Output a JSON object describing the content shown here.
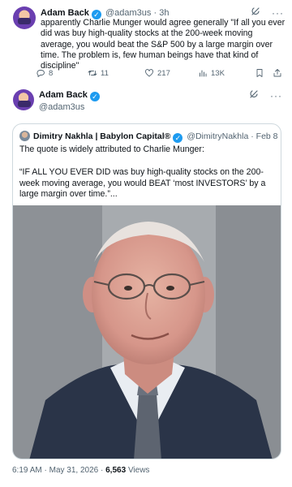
{
  "tweet": {
    "author_name": "Adam Back",
    "author_handle": "@adam3us",
    "sep": "·",
    "age": "3h",
    "text": "apparently Charlie Munger would agree generally \"If all you ever did was buy high-quality stocks at the 200-week moving average, you would beat the S&P 500 by a large margin over time. The problem is, few human beings have that kind of discipline\"",
    "actions": {
      "replies": "8",
      "retweets": "11",
      "likes": "217",
      "views": "13K"
    }
  },
  "reply": {
    "author_name": "Adam Back",
    "author_handle": "@adam3us"
  },
  "quote": {
    "author_name": "Dimitry Nakhla | Babylon Capital®",
    "author_handle": "@DimitryNakhla",
    "sep": "·",
    "date": "Feb 8",
    "text_line1": "The quote is widely attributed to Charlie Munger:",
    "text_line2": "“IF ALL YOU EVER DID was buy high-quality stocks on the 200-week moving average, you would BEAT ‘most INVESTORS’ by a large margin over time.”..."
  },
  "meta": {
    "time": "6:19 AM",
    "sep1": "·",
    "date": "May 31, 2026",
    "sep2": "·",
    "views_count": "6,563",
    "views_label": "Views"
  },
  "icons": {
    "verified": "verified-badge-icon",
    "grok": "grok-icon",
    "more": "more-icon",
    "reply": "reply-icon",
    "retweet": "retweet-icon",
    "like": "like-icon",
    "views": "views-icon",
    "bookmark": "bookmark-icon",
    "share": "share-icon"
  },
  "colors": {
    "accent": "#1d9bf0",
    "muted": "#536471",
    "border": "#cfd9de"
  }
}
